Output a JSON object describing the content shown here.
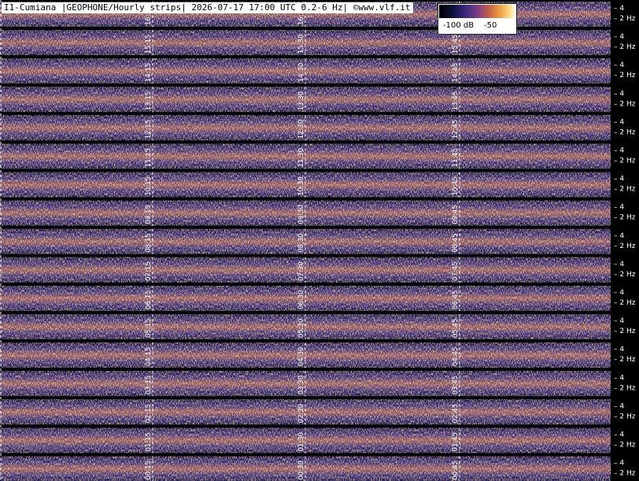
{
  "title": "I1-Cumiana |GEOPHONE/Hourly strips| 2026-07-17 17:00 UTC 0.2-6 Hz| ©www.vlf.it",
  "colorbar": {
    "min_label": "-100 dB",
    "max_label": "-50"
  },
  "colors": {
    "background": "#000000",
    "low": "#3a2a80",
    "mid": "#c0604a",
    "high": "#ffe8a0"
  },
  "chart_data": {
    "type": "heatmap",
    "title": "I1-Cumiana |GEOPHONE/Hourly strips| 2026-07-17 17:00 UTC 0.2-6 Hz| ©www.vlf.it",
    "xlabel": "",
    "ylabel": "",
    "y_ticks": [
      "4",
      "2 Hz"
    ],
    "strips": [
      {
        "hour": 16,
        "time_labels": [
          "16:15",
          "16:30",
          "16:45"
        ]
      },
      {
        "hour": 15,
        "time_labels": [
          "15:15",
          "15:30",
          "15:45"
        ]
      },
      {
        "hour": 14,
        "time_labels": [
          "14:15",
          "14:30",
          "14:45"
        ]
      },
      {
        "hour": 13,
        "time_labels": [
          "13:15",
          "13:30",
          "13:45"
        ]
      },
      {
        "hour": 12,
        "time_labels": [
          "12:15",
          "12:30",
          "12:45"
        ]
      },
      {
        "hour": 11,
        "time_labels": [
          "11:15",
          "11:30",
          "11:45"
        ]
      },
      {
        "hour": 10,
        "time_labels": [
          "10:15",
          "10:30",
          "10:45"
        ]
      },
      {
        "hour": 9,
        "time_labels": [
          "09:15",
          "09:30",
          "09:45"
        ]
      },
      {
        "hour": 8,
        "time_labels": [
          "08:15",
          "08:30",
          "08:45"
        ]
      },
      {
        "hour": 7,
        "time_labels": [
          "07:15",
          "07:30",
          "07:45"
        ]
      },
      {
        "hour": 6,
        "time_labels": [
          "06:15",
          "06:30",
          "06:45"
        ]
      },
      {
        "hour": 5,
        "time_labels": [
          "05:15",
          "05:30",
          "05:45"
        ]
      },
      {
        "hour": 4,
        "time_labels": [
          "04:15",
          "04:30",
          "04:45"
        ]
      },
      {
        "hour": 3,
        "time_labels": [
          "03:15",
          "03:30",
          "03:45"
        ]
      },
      {
        "hour": 2,
        "time_labels": [
          "02:15",
          "02:30",
          "02:45"
        ]
      },
      {
        "hour": 1,
        "time_labels": [
          "01:15",
          "01:30",
          "01:45"
        ]
      },
      {
        "hour": 0,
        "time_labels": [
          "00:15",
          "00:30",
          "00:45"
        ]
      }
    ],
    "colorbar_range_db": [
      -100,
      -50
    ],
    "grid": true
  }
}
